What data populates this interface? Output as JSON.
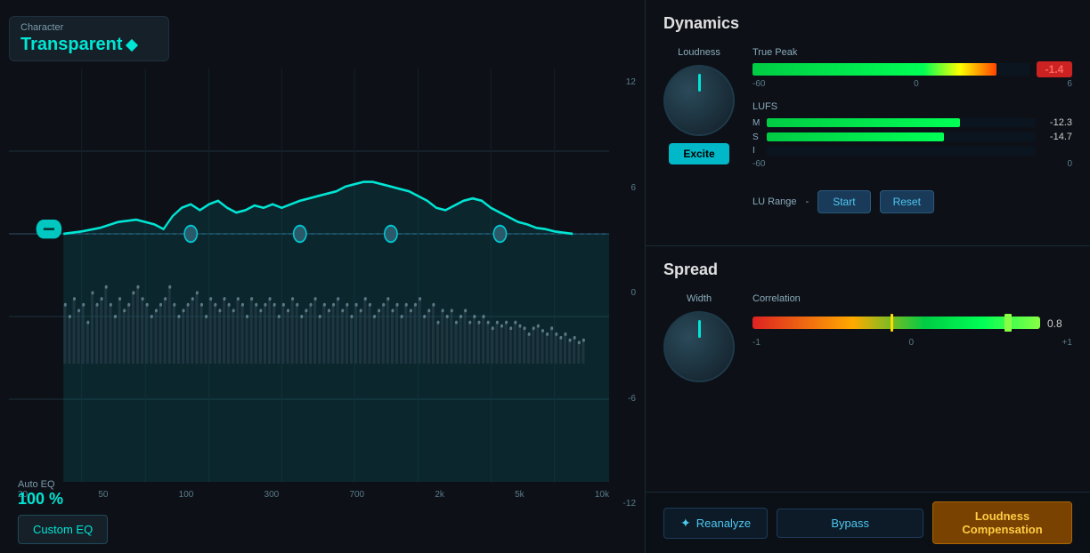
{
  "character": {
    "label": "Character",
    "value": "Transparent"
  },
  "eq": {
    "auto_eq_label": "Auto EQ",
    "auto_eq_value": "100 %",
    "custom_eq_btn": "Custom EQ",
    "x_labels": [
      "20",
      "50",
      "100",
      "300",
      "700",
      "2k",
      "5k",
      "10k"
    ],
    "y_labels": [
      "12",
      "6",
      "0",
      "-6",
      "-12"
    ]
  },
  "dynamics": {
    "title": "Dynamics",
    "loudness_label": "Loudness",
    "excite_btn": "Excite",
    "true_peak_label": "True Peak",
    "true_peak_value": "-1.4",
    "true_peak_scale_left": "-60",
    "true_peak_scale_mid": "0",
    "true_peak_scale_right": "6",
    "lufs_label": "LUFS",
    "lufs_m_label": "M",
    "lufs_m_value": "-12.3",
    "lufs_s_label": "S",
    "lufs_s_value": "-14.7",
    "lufs_i_label": "I",
    "lufs_i_value": "",
    "lufs_scale_left": "-60",
    "lufs_scale_right": "0",
    "lu_range_label": "LU Range",
    "lu_range_value": "-",
    "start_btn": "Start",
    "reset_btn": "Reset"
  },
  "spread": {
    "title": "Spread",
    "width_label": "Width",
    "correlation_label": "Correlation",
    "corr_value": "0.8",
    "corr_scale_left": "-1",
    "corr_scale_mid": "0",
    "corr_scale_right": "+1"
  },
  "bottom_bar": {
    "reanalyze_btn": "Reanalyze",
    "bypass_btn": "Bypass",
    "loudness_comp_btn": "Loudness Compensation"
  }
}
